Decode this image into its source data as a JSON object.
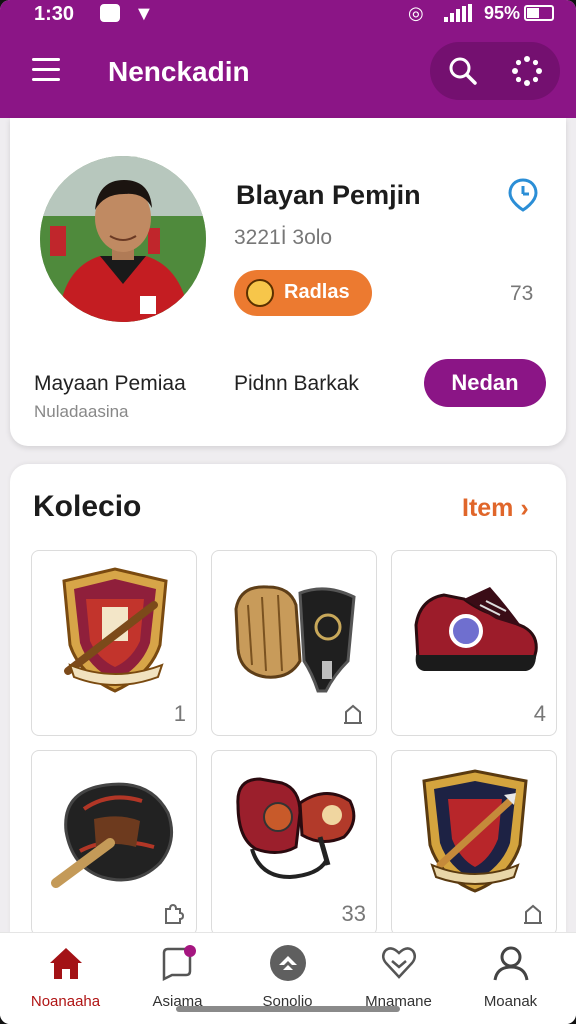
{
  "status_bar": {
    "time": "1:30",
    "battery": "95%"
  },
  "app_bar": {
    "title": "Nenckadin",
    "icons": [
      "menu-icon",
      "search-icon",
      "loader-icon"
    ]
  },
  "profile": {
    "name": "Blayan Pemjin",
    "player_id": "3221İ 3olo",
    "badge_label": "Radlas",
    "rank_number": "73",
    "stat1_label": "Mayaan Pemiaa",
    "stat1_sub": "Nuladaasina",
    "stat2_label": "Pidnn Barkak",
    "action_button": "Nedan"
  },
  "collection": {
    "title": "Kolecio",
    "link_label": "Item ›",
    "items": [
      {
        "name": "shield-crest",
        "count": "1"
      },
      {
        "name": "glove-guard",
        "icon": "bookmark-icon"
      },
      {
        "name": "sneaker",
        "count": "4"
      },
      {
        "name": "baseball-glove",
        "icon": "puzzle-icon"
      },
      {
        "name": "boxing-gloves",
        "count": "33"
      },
      {
        "name": "shield-arrows",
        "icon": "bookmark-icon"
      }
    ]
  },
  "bottom_nav": [
    {
      "label": "Noanaaha",
      "icon": "home-icon",
      "active": true
    },
    {
      "label": "Asiama",
      "icon": "chat-icon",
      "active": false
    },
    {
      "label": "Sonolio",
      "icon": "navigation-icon",
      "active": false
    },
    {
      "label": "Mnamane",
      "icon": "heart-icon",
      "active": false
    },
    {
      "label": "Moanak",
      "icon": "profile-icon",
      "active": false
    }
  ],
  "colors": {
    "primary": "#8b1586",
    "accent": "#ec7a30",
    "active_nav": "#b01515"
  }
}
